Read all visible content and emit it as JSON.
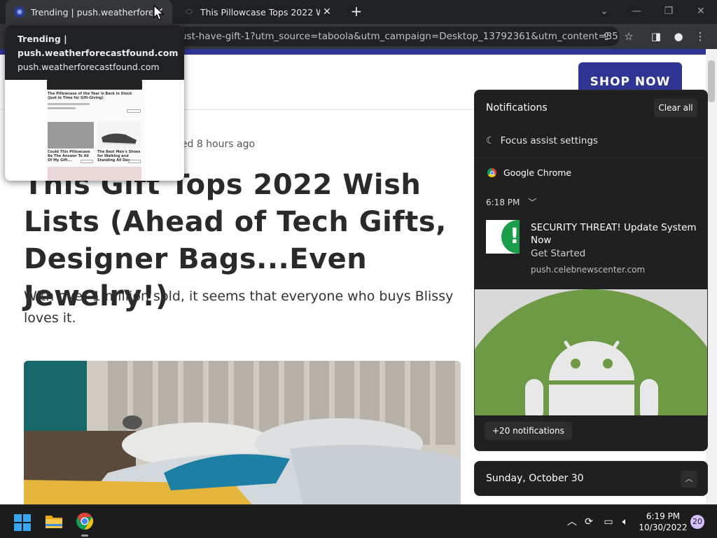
{
  "browser": {
    "tabs": [
      {
        "title": "Trending | push.weatherforecastfo",
        "close": "✕"
      },
      {
        "title": "This Pillowcase Tops 2022 Wish L",
        "close": "✕"
      }
    ],
    "new_tab": "+",
    "url": "ust-have-gift-1?utm_source=taboola&utm_campaign=Desktop_13792361&utm_content=357..."
  },
  "hover_card": {
    "title_line1": "Trending |",
    "title_line2": "push.weatherforecastfound.com",
    "domain": "push.weatherforecastfound.com",
    "thumb": {
      "item1": "The Pillowcase of the Year is Back in Stock (Just in Time for Gift-Giving)",
      "item2": "Could This Pillowcase Be The Answer To All Of My Gift...",
      "item3": "The Best Men's Shoes for Walking and Standing All Day"
    }
  },
  "page": {
    "shop_now": "SHOP NOW",
    "published": "hed 8 hours ago",
    "headline": "This Gift Tops 2022 Wish Lists (Ahead of Tech Gifts, Designer Bags...Even Jewelry!)",
    "subhead": "With over 1 million sold, it seems that everyone who buys Blissy loves it."
  },
  "notifications": {
    "title": "Notifications",
    "clear_all": "Clear all",
    "focus_assist": "Focus assist settings",
    "app_name": "Google Chrome",
    "time": "6:18 PM",
    "card": {
      "title": "SECURITY THREAT! Update System Now",
      "subtitle": "Get Started",
      "source": "push.celebnewscenter.com",
      "icon_glyph": "!"
    },
    "more": "+20 notifications"
  },
  "calendar": {
    "date": "Sunday, October 30"
  },
  "taskbar": {
    "time": "6:19 PM",
    "date": "10/30/2022",
    "badge": "20"
  },
  "colors": {
    "brand_navy": "#2e3592",
    "android_green": "#6f9a45",
    "alert_green": "#1a9e4b"
  }
}
